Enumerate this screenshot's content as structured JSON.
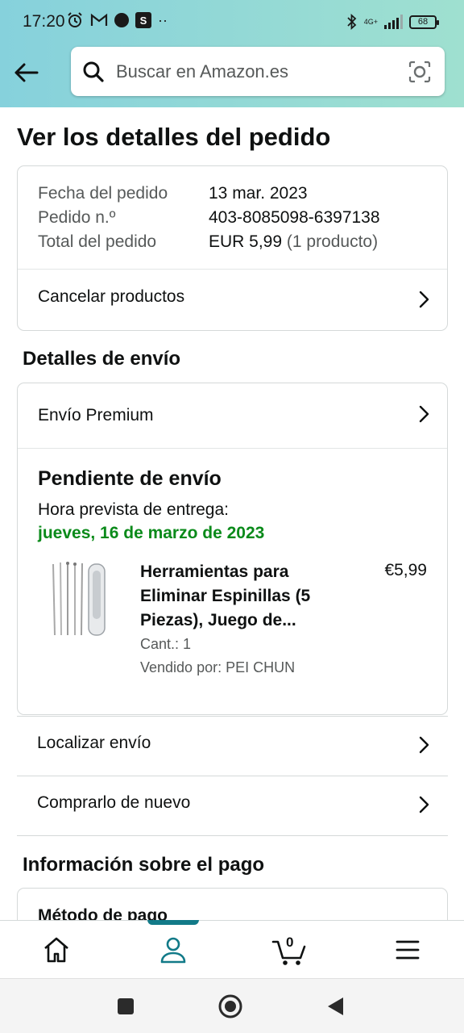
{
  "status_bar": {
    "time": "17:20",
    "network": "4G+",
    "battery": "68"
  },
  "header": {
    "search_placeholder": "Buscar en Amazon.es",
    "brand_color": "#86d1dc"
  },
  "page": {
    "title": "Ver los detalles del pedido"
  },
  "order_summary": {
    "rows": [
      {
        "label": "Fecha del pedido",
        "value": "13 mar. 2023",
        "extra": ""
      },
      {
        "label": "Pedido n.º",
        "value": "403-8085098-6397138",
        "extra": ""
      },
      {
        "label": "Total del pedido",
        "value": "EUR 5,99",
        "extra": " (1 producto)"
      }
    ],
    "cancel_label": "Cancelar productos"
  },
  "shipping": {
    "section_title": "Detalles de envío",
    "method_label": "Envío Premium",
    "status": "Pendiente de envío",
    "eta_label": "Hora prevista de entrega:",
    "eta_date": "jueves, 16 de marzo de 2023",
    "product": {
      "title": "Herramientas para Eliminar Espinillas (5 Piezas), Juego de...",
      "price": "€5,99",
      "qty": "Cant.: 1",
      "seller": "Vendido por: PEI CHUN"
    },
    "track_label": "Localizar envío",
    "buy_again_label": "Comprarlo de nuevo"
  },
  "payment": {
    "section_title": "Información sobre el pago",
    "method_title": "Método de pago"
  },
  "bottom_nav": {
    "cart_count": "0",
    "active_color": "#127a88",
    "items": [
      "home-icon",
      "account-icon",
      "cart-icon",
      "menu-icon"
    ]
  }
}
